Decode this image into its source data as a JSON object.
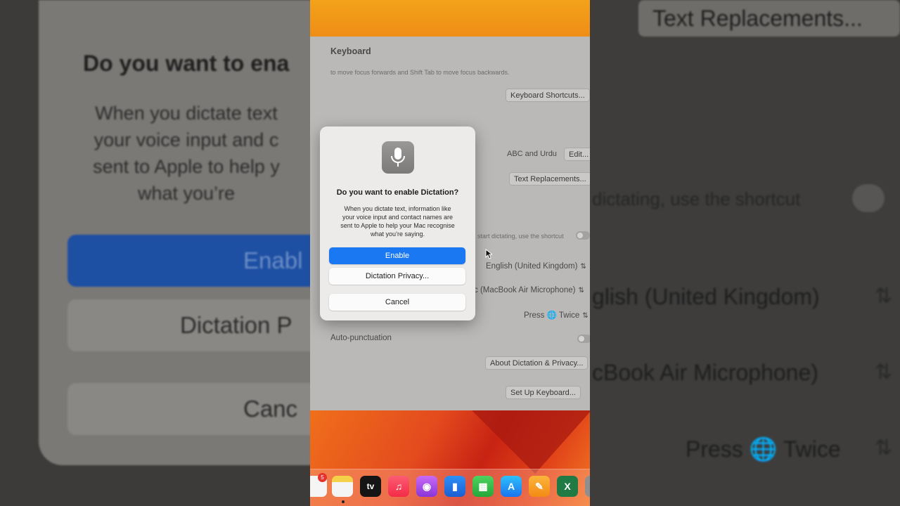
{
  "zoom_left": {
    "title": "Do you want to ena",
    "body_lines": [
      "When you dictate text",
      "your voice input and c",
      "sent to Apple to help y",
      "what you’re"
    ],
    "enable_label": "Enabl",
    "privacy_label": "Dictation P",
    "cancel_label": "Canc"
  },
  "zoom_right": {
    "text_replacements": "Text Replacements...",
    "shortcut_text": "dictating, use the shortcut",
    "language": "glish (United Kingdom)",
    "microphone": "cBook Air Microphone)",
    "press_twice": "Press 🌐 Twice"
  },
  "settings": {
    "header": "Keyboard",
    "hint": "to move focus forwards and Shift Tab to move focus backwards.",
    "keyboard_shortcuts": "Keyboard Shortcuts...",
    "input_sources_value": "ABC and Urdu",
    "edit_label": "Edit...",
    "text_replacements": "Text Replacements...",
    "shortcut_hint": "start dictating, use the shortcut",
    "language_value": "English (United Kingdom)",
    "microphone_value": "c (MacBook Air Microphone)",
    "shortcut_value": "Press 🌐 Twice",
    "auto_punctuation": "Auto-punctuation",
    "about_dictation": "About Dictation & Privacy...",
    "setup_keyboard": "Set Up Keyboard..."
  },
  "dialog": {
    "icon": "microphone-icon",
    "title": "Do you want to enable Dictation?",
    "body_lines": [
      "When you dictate text, information like",
      "your voice input and contact names are",
      "sent to Apple to help your Mac recognise",
      "what you’re saying."
    ],
    "enable_label": "Enable",
    "privacy_label": "Dictation Privacy...",
    "cancel_label": "Cancel"
  },
  "dock": {
    "badge_count": "5",
    "tv_label": "tv",
    "icons": [
      "reminders-icon",
      "notes-icon",
      "apple-tv-icon",
      "music-icon",
      "podcasts-icon",
      "keynote-icon",
      "numbers-icon",
      "app-store-icon",
      "pages-icon",
      "excel-icon",
      "settings-icon"
    ]
  },
  "colors": {
    "accent": "#1b78f3",
    "wallpaper_top": "#f3a21a",
    "wallpaper_bottom": "#c82313"
  }
}
